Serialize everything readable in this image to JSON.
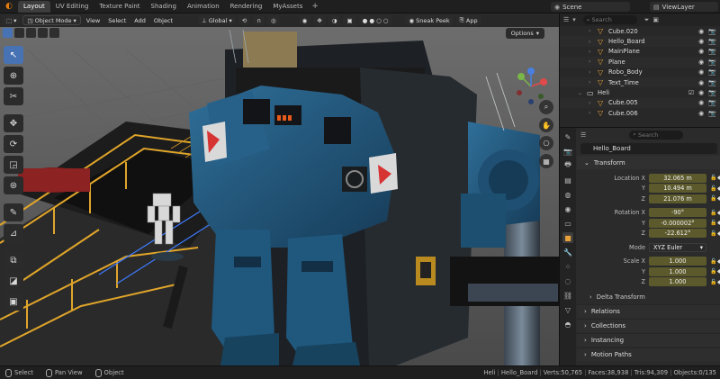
{
  "topbar": {
    "tabs": [
      "Layout",
      "UV Editing",
      "Texture Paint",
      "Shading",
      "Animation",
      "Rendering",
      "MyAssets"
    ],
    "active_tab": "Layout",
    "scene": "Scene",
    "view_layer": "ViewLayer"
  },
  "viewport_header": {
    "mode": "Object Mode",
    "menus": [
      "View",
      "Select",
      "Add",
      "Object"
    ],
    "orientation": "Global",
    "sneak_peek": "Sneak Peek",
    "app_btn": "App",
    "options": "Options"
  },
  "outliner": {
    "search_placeholder": "Search",
    "rows": [
      {
        "name": "Cube.020",
        "extra": "",
        "selected": false
      },
      {
        "name": "Hello_Board",
        "extra": "",
        "selected": true
      },
      {
        "name": "MainPlane",
        "extra": "",
        "selected": false
      },
      {
        "name": "Plane",
        "extra": "",
        "selected": false
      },
      {
        "name": "Robo_Body",
        "extra": "",
        "selected": false
      },
      {
        "name": "Text_Time",
        "extra": "",
        "selected": false
      }
    ],
    "collection": "Heli",
    "heli_rows": [
      {
        "name": "Cube.005"
      },
      {
        "name": "Cube.006"
      }
    ]
  },
  "properties": {
    "search_placeholder": "Search",
    "object_name": "Hello_Board",
    "transform_title": "Transform",
    "location_label": "Location X",
    "location": {
      "x": "32.065 m",
      "y": "10.494 m",
      "z": "21.076 m"
    },
    "rotation_label": "Rotation X",
    "rotation": {
      "x": "-90°",
      "y": "-0.000002°",
      "z": "-22.612°"
    },
    "mode_label": "Mode",
    "mode_value": "XYZ Euler",
    "scale_label": "Scale X",
    "scale": {
      "x": "1.000",
      "y": "1.000",
      "z": "1.000"
    },
    "axis_y": "Y",
    "axis_z": "Z",
    "delta_transform": "Delta Transform",
    "panels": [
      "Relations",
      "Collections",
      "Instancing",
      "Motion Paths"
    ]
  },
  "statusbar": {
    "select": "Select",
    "pan_view": "Pan View",
    "object": "Object",
    "stats": [
      "Heli",
      "Hello_Board",
      "Verts:50,765",
      "Faces:38,938",
      "Tris:94,309",
      "Objects:0/135"
    ]
  }
}
